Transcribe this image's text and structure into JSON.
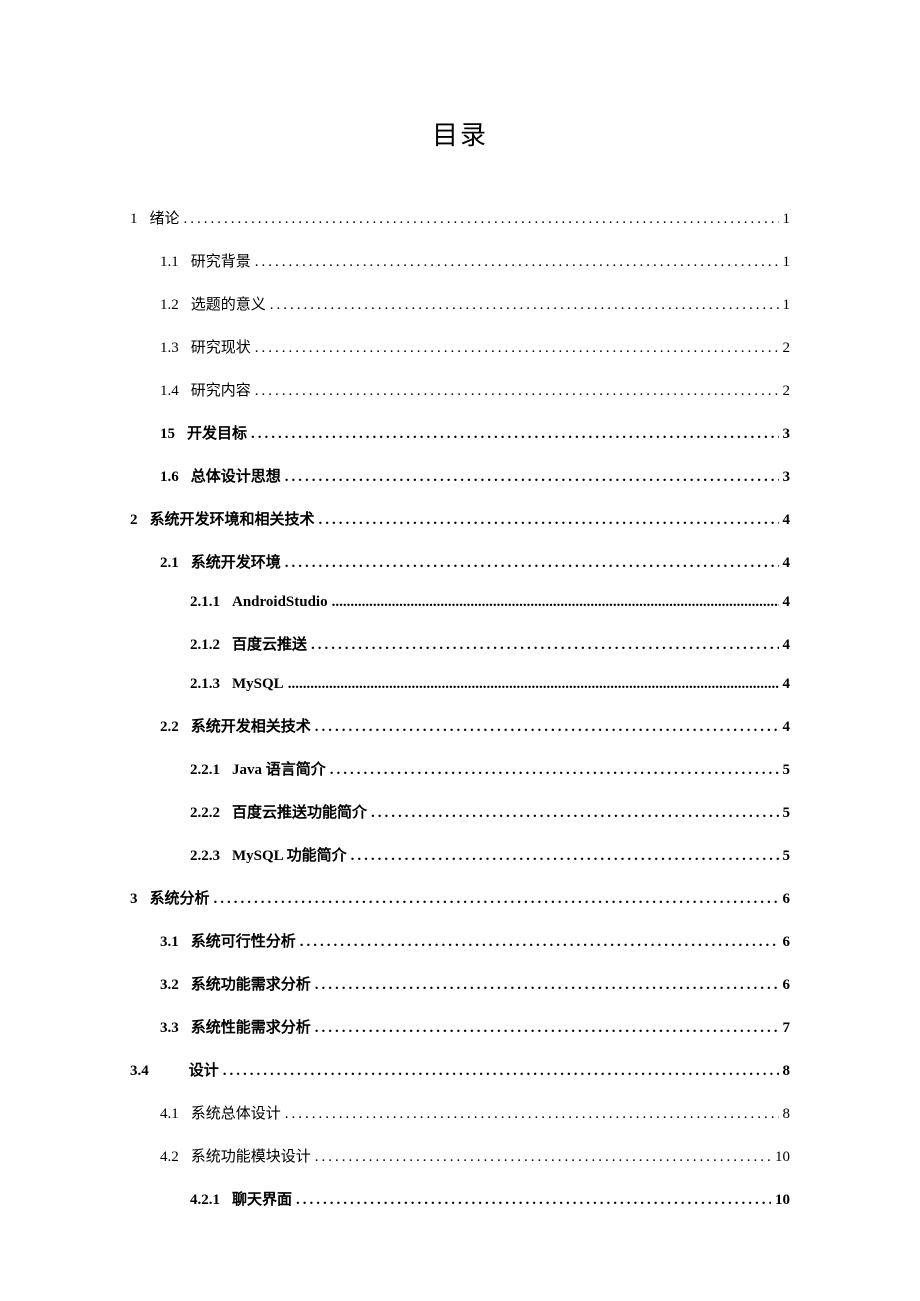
{
  "title": "目录",
  "entries": [
    {
      "level": 1,
      "bold": false,
      "num": "1",
      "cjknum": true,
      "label": "绪论",
      "page": "1",
      "tight": false
    },
    {
      "level": 2,
      "bold": false,
      "num": "1.1",
      "cjknum": false,
      "label": "研究背景",
      "page": "1",
      "tight": false
    },
    {
      "level": 2,
      "bold": false,
      "num": "1.2",
      "cjknum": false,
      "label": "选题的意义",
      "page": "1",
      "tight": false
    },
    {
      "level": 2,
      "bold": false,
      "num": "1.3",
      "cjknum": false,
      "label": "研究现状",
      "page": "2",
      "tight": false
    },
    {
      "level": 2,
      "bold": false,
      "num": "1.4",
      "cjknum": false,
      "label": "研究内容",
      "page": "2",
      "tight": false
    },
    {
      "level": 2,
      "bold": true,
      "num": "15",
      "cjknum": false,
      "label": "开发目标",
      "page": "3",
      "tight": false
    },
    {
      "level": 2,
      "bold": true,
      "num": "1.6",
      "cjknum": false,
      "label": "总体设计思想",
      "page": "3",
      "tight": false
    },
    {
      "level": 1,
      "bold": true,
      "num": "2",
      "cjknum": true,
      "label": "系统开发环境和相关技术",
      "page": "4",
      "tight": false
    },
    {
      "level": 2,
      "bold": true,
      "num": "2.1",
      "cjknum": false,
      "label": "系统开发环境",
      "page": "4",
      "tight": false
    },
    {
      "level": 3,
      "bold": true,
      "num": "2.1.1",
      "cjknum": false,
      "label": "AndroidStudio",
      "page": "4",
      "tight": true
    },
    {
      "level": 3,
      "bold": true,
      "num": "2.1.2",
      "cjknum": false,
      "label": "百度云推送",
      "page": "4",
      "tight": false
    },
    {
      "level": 3,
      "bold": true,
      "num": "2.1.3",
      "cjknum": false,
      "label": "MySQL",
      "page": "4",
      "tight": true
    },
    {
      "level": 2,
      "bold": true,
      "num": "2.2",
      "cjknum": false,
      "label": "系统开发相关技术",
      "page": "4",
      "tight": false
    },
    {
      "level": 3,
      "bold": true,
      "num": "2.2.1",
      "cjknum": false,
      "label": "Java 语言简介",
      "page": "5",
      "tight": false
    },
    {
      "level": 3,
      "bold": true,
      "num": "2.2.2",
      "cjknum": false,
      "label": "百度云推送功能简介",
      "page": "5",
      "tight": false
    },
    {
      "level": 3,
      "bold": true,
      "num": "2.2.3",
      "cjknum": false,
      "label": "MySQL 功能简介",
      "page": "5",
      "tight": false
    },
    {
      "level": 1,
      "bold": true,
      "num": "3",
      "cjknum": true,
      "label": "系统分析",
      "page": "6",
      "tight": false
    },
    {
      "level": 2,
      "bold": true,
      "num": "3.1",
      "cjknum": false,
      "label": "系统可行性分析",
      "page": "6",
      "tight": false
    },
    {
      "level": 2,
      "bold": true,
      "num": "3.2",
      "cjknum": false,
      "label": "系统功能需求分析",
      "page": "6",
      "tight": false
    },
    {
      "level": 2,
      "bold": true,
      "num": "3.3",
      "cjknum": false,
      "label": "系统性能需求分析",
      "page": "7",
      "tight": false
    },
    {
      "level": 1,
      "bold": true,
      "num": "3.4",
      "cjknum": false,
      "label": "设计",
      "gap": true,
      "page": "8",
      "tight": false
    },
    {
      "level": 2,
      "bold": false,
      "num": "4.1",
      "cjknum": false,
      "label": "系统总体设计",
      "page": "8",
      "tight": false
    },
    {
      "level": 2,
      "bold": false,
      "num": "4.2",
      "cjknum": false,
      "label": "系统功能模块设计",
      "page": "10",
      "tight": false
    },
    {
      "level": 3,
      "bold": true,
      "num": "4.2.1",
      "cjknum": false,
      "label": "聊天界面",
      "page": "10",
      "tight": false
    }
  ],
  "dotchar": ".",
  "dotchar_tight": "."
}
